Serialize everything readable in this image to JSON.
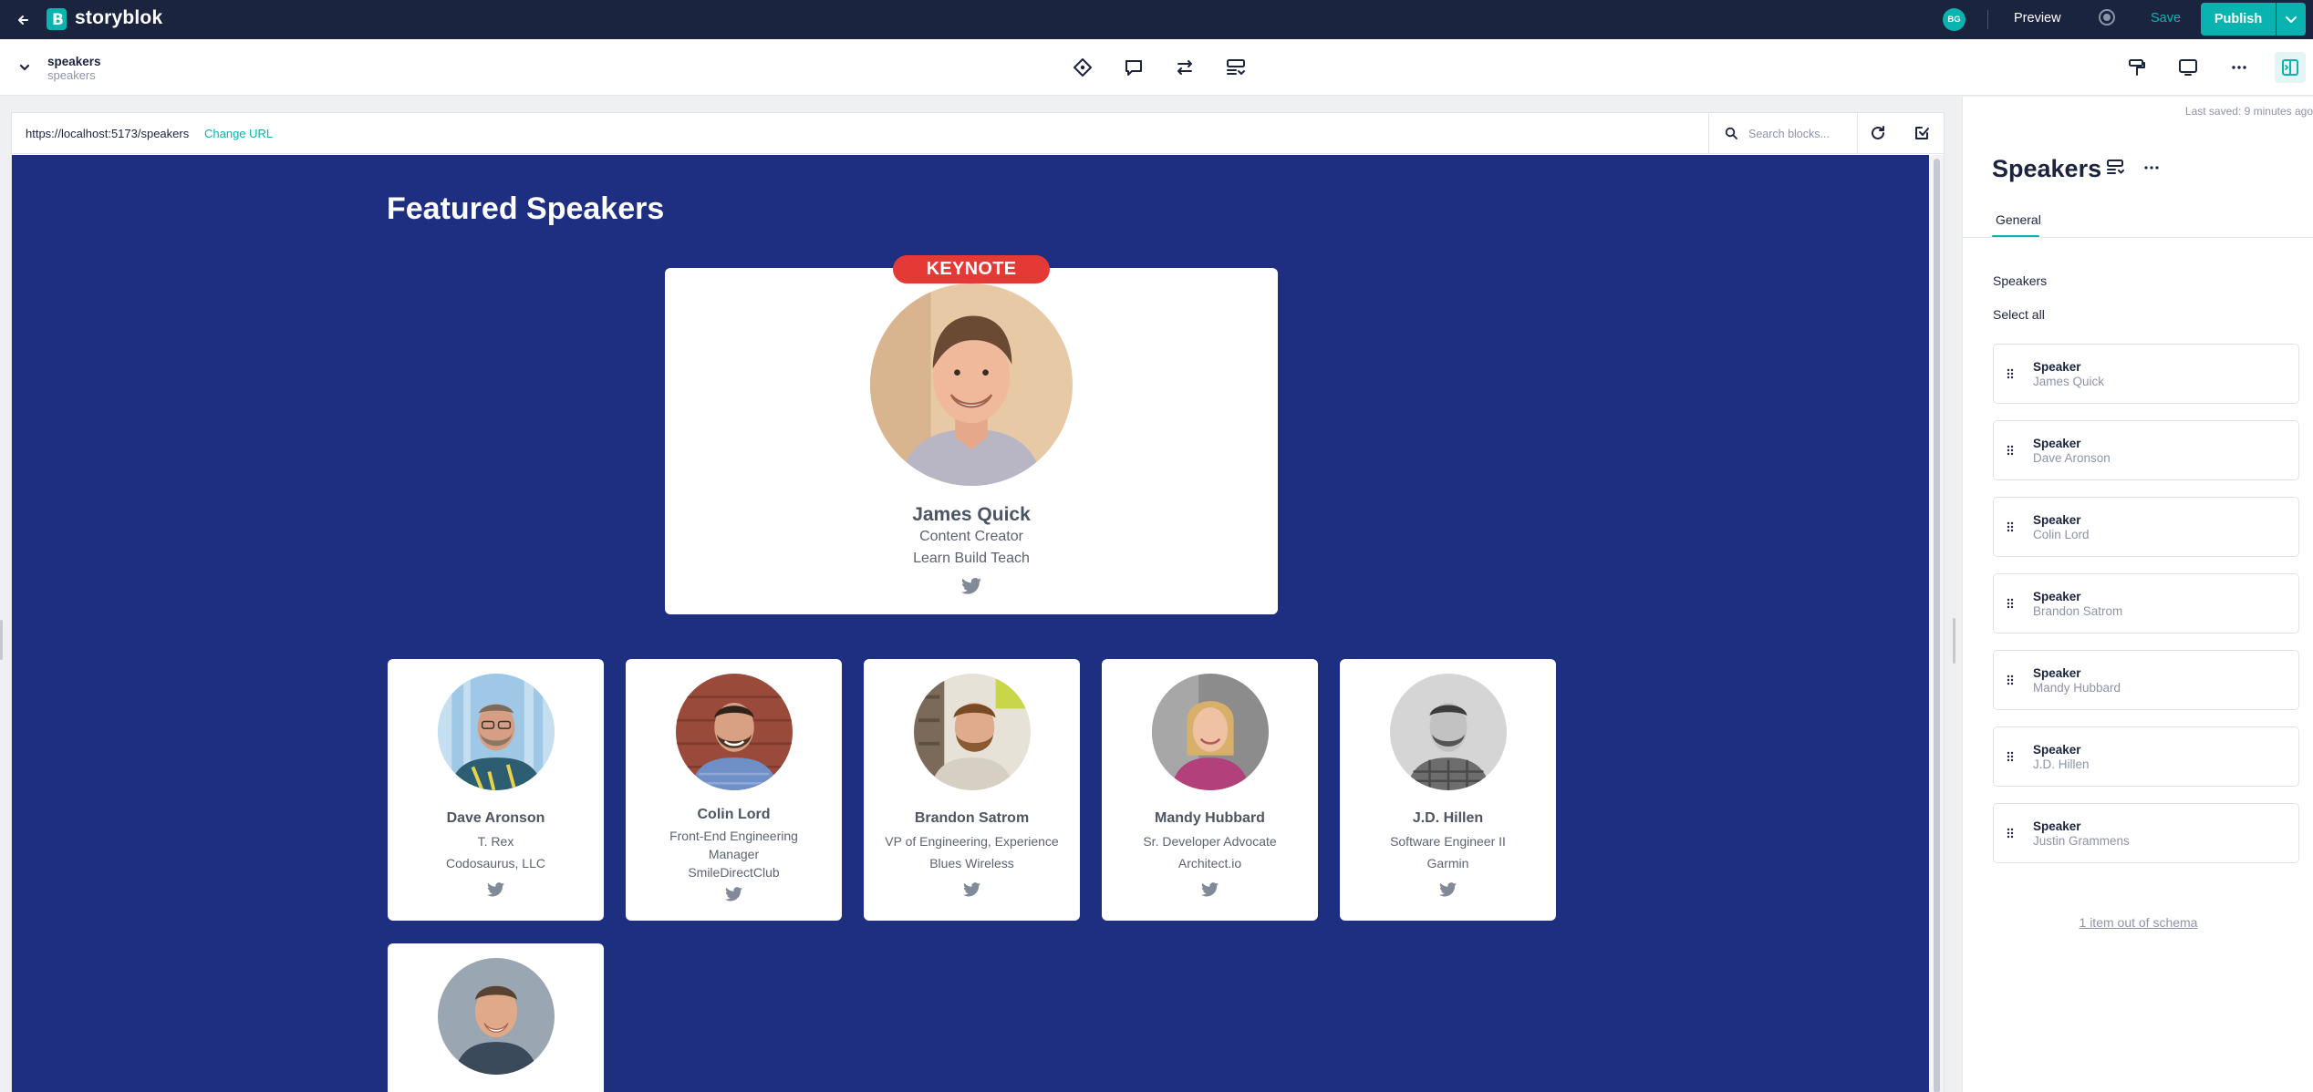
{
  "app": {
    "name": "storyblok",
    "logo_letter": "B",
    "user_initials": "BG"
  },
  "topbar": {
    "preview_label": "Preview",
    "save_label": "Save",
    "publish_label": "Publish"
  },
  "story": {
    "title": "speakers",
    "slug": "speakers"
  },
  "preview": {
    "url": "https://localhost:5173/speakers",
    "change_url_label": "Change URL",
    "search_placeholder": "Search blocks..."
  },
  "site": {
    "heading": "Featured Speakers",
    "keynote_badge": "KEYNOTE",
    "keynote": {
      "name": "James Quick",
      "line1": "Content Creator",
      "line2": "Learn Build Teach"
    },
    "speakers": [
      {
        "name": "Dave Aronson",
        "line1": "T. Rex",
        "line2": "Codosaurus, LLC"
      },
      {
        "name": "Colin Lord",
        "line1": "Front-End Engineering",
        "line1b": "Manager",
        "line2": "SmileDirectClub"
      },
      {
        "name": "Brandon Satrom",
        "line1": "VP of Engineering, Experience",
        "line2": "Blues Wireless"
      },
      {
        "name": "Mandy Hubbard",
        "line1": "Sr. Developer Advocate",
        "line2": "Architect.io"
      },
      {
        "name": "J.D. Hillen",
        "line1": "Software Engineer II",
        "line2": "Garmin"
      }
    ]
  },
  "panel": {
    "last_saved": "Last saved: 9 minutes ago",
    "title": "Speakers",
    "tab": "General",
    "field_label": "Speakers",
    "select_all": "Select all",
    "blocks": [
      {
        "type": "Speaker",
        "name": "James Quick"
      },
      {
        "type": "Speaker",
        "name": "Dave Aronson"
      },
      {
        "type": "Speaker",
        "name": "Colin Lord"
      },
      {
        "type": "Speaker",
        "name": "Brandon Satrom"
      },
      {
        "type": "Speaker",
        "name": "Mandy Hubbard"
      },
      {
        "type": "Speaker",
        "name": "J.D. Hillen"
      },
      {
        "type": "Speaker",
        "name": "Justin Grammens"
      }
    ],
    "schema_note": "1 item out of schema"
  },
  "colors": {
    "brand": "#09b3af",
    "dark": "#1b243f",
    "site_bg": "#1e2e80",
    "keynote": "#e53935"
  }
}
